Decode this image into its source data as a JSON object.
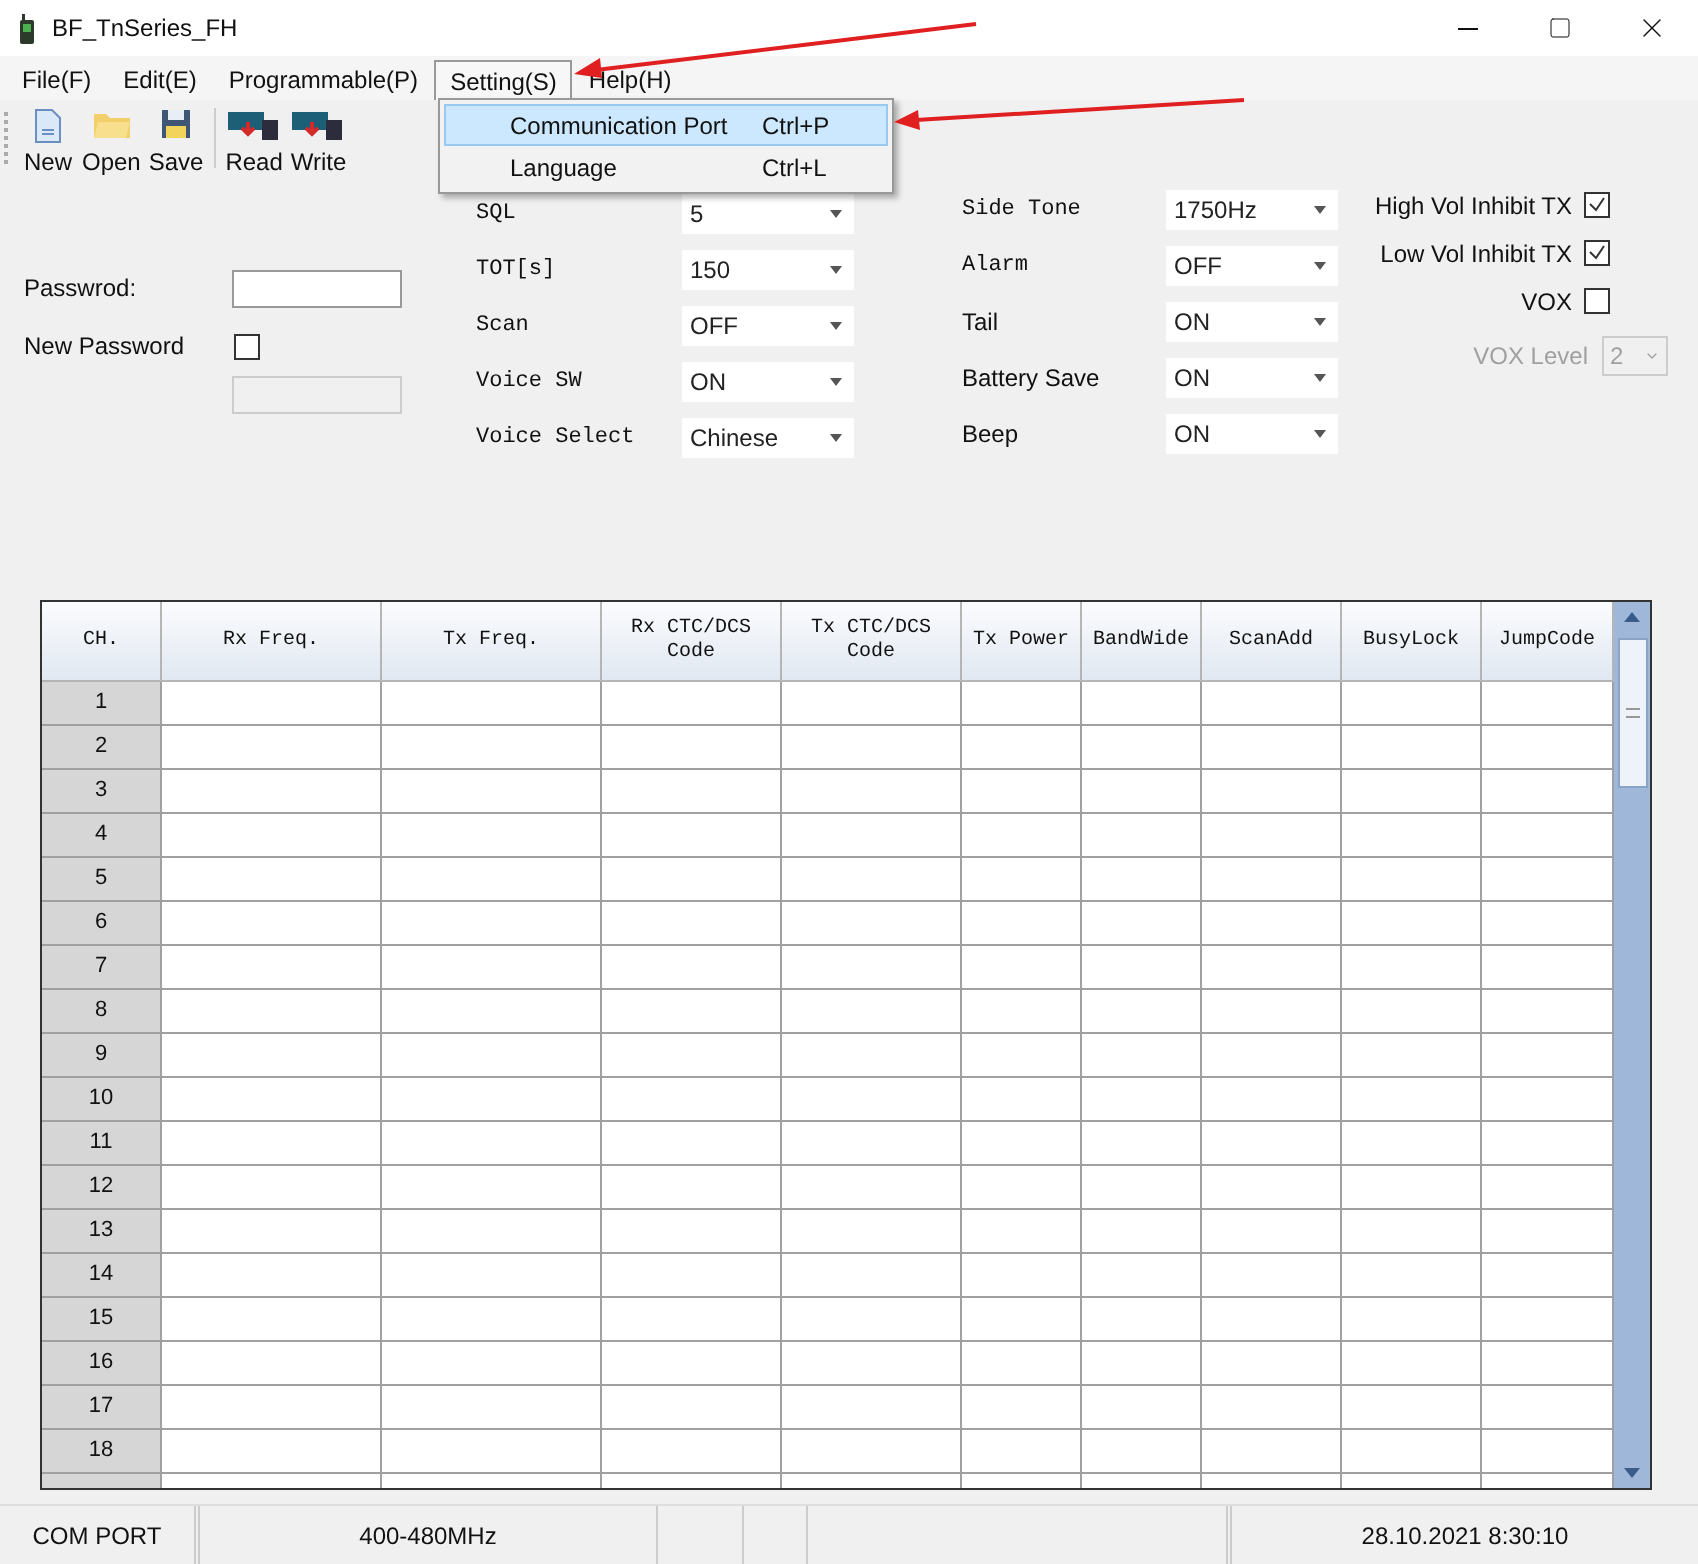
{
  "window": {
    "title": "BF_TnSeries_FH"
  },
  "menu": [
    {
      "label": "File(F)",
      "selected": false
    },
    {
      "label": "Edit(E)",
      "selected": false
    },
    {
      "label": "Programmable(P)",
      "selected": false
    },
    {
      "label": "Setting(S)",
      "selected": true
    },
    {
      "label": "Help(H)",
      "selected": false
    }
  ],
  "dropdown": [
    {
      "label": "Communication Port",
      "shortcut": "Ctrl+P",
      "selected": true
    },
    {
      "label": "Language",
      "shortcut": "Ctrl+L",
      "selected": false
    }
  ],
  "toolbar": [
    {
      "label": "New",
      "kind": "new"
    },
    {
      "label": "Open",
      "kind": "open"
    },
    {
      "label": "Save",
      "kind": "save"
    },
    {
      "label": "Read",
      "kind": "read"
    },
    {
      "label": "Write",
      "kind": "write"
    }
  ],
  "password": {
    "label": "Passwrod:",
    "new_label": "New Password",
    "new_checked": false
  },
  "settings_left": [
    {
      "label": "SQL",
      "value": "5"
    },
    {
      "label": "TOT[s]",
      "value": "150"
    },
    {
      "label": "Scan",
      "value": "OFF"
    },
    {
      "label": "Voice SW",
      "value": "ON"
    },
    {
      "label": "Voice Select",
      "value": "Chinese"
    }
  ],
  "settings_right": [
    {
      "label": "Side Tone",
      "value": "1750Hz"
    },
    {
      "label": "Alarm",
      "value": "OFF"
    },
    {
      "label": "Tail",
      "value": "ON"
    },
    {
      "label": "Battery Save",
      "value": "ON"
    },
    {
      "label": "Beep",
      "value": "ON"
    }
  ],
  "options": [
    {
      "label": "High Vol Inhibit TX",
      "checked": true
    },
    {
      "label": "Low Vol Inhibit TX",
      "checked": true
    },
    {
      "label": "VOX",
      "checked": false
    }
  ],
  "vox_level": {
    "label": "VOX Level",
    "value": "2",
    "disabled": true
  },
  "table": {
    "columns": [
      "CH.",
      "Rx Freq.",
      "Tx Freq.",
      "Rx CTC/DCS Code",
      "Tx CTC/DCS Code",
      "Tx Power",
      "BandWide",
      "ScanAdd",
      "BusyLock",
      "JumpCode"
    ],
    "rows": [
      "1",
      "2",
      "3",
      "4",
      "5",
      "6",
      "7",
      "8",
      "9",
      "10",
      "11",
      "12",
      "13",
      "14",
      "15",
      "16",
      "17",
      "18"
    ]
  },
  "status_bar": {
    "port": "COM PORT",
    "band": "400-480MHz",
    "datetime": "28.10.2021 8:30:10"
  }
}
